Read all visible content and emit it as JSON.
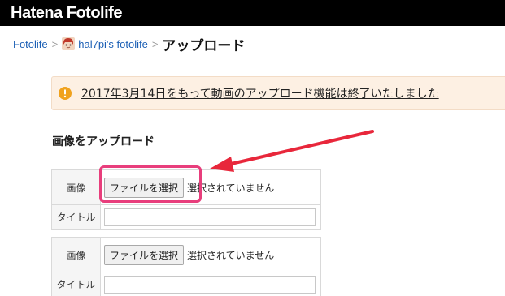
{
  "header": {
    "logo_text": "Hatena Fotolife"
  },
  "breadcrumb": {
    "root": "Fotolife",
    "user": "hal7pi's fotolife",
    "separator": ">",
    "current": "アップロード"
  },
  "notice": {
    "text": "2017年3月14日をもって動画のアップロード機能は終了いたしました",
    "icon": "warning-icon"
  },
  "upload": {
    "section_title": "画像をアップロード",
    "entries": [
      {
        "image_label": "画像",
        "file_button": "ファイルを選択",
        "file_status": "選択されていません",
        "title_label": "タイトル",
        "title_value": ""
      },
      {
        "image_label": "画像",
        "file_button": "ファイルを選択",
        "file_status": "選択されていません",
        "title_label": "タイトル",
        "title_value": ""
      }
    ]
  },
  "colors": {
    "header_bg": "#000000",
    "link": "#1b5fb5",
    "notice_bg": "#fdf0e3",
    "warning_icon": "#f0a21e",
    "annotation": "#e83e7c",
    "arrow": "#e8273b"
  }
}
